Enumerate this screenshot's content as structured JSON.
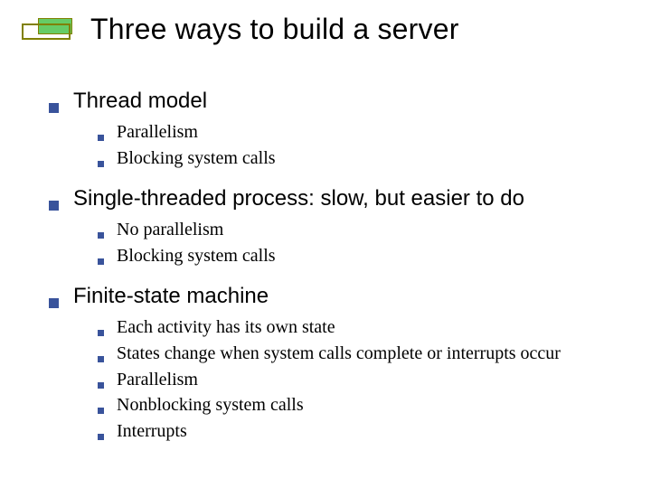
{
  "title": "Three ways to build a server",
  "items": [
    {
      "label": "Thread model",
      "sub": [
        "Parallelism",
        "Blocking system calls"
      ]
    },
    {
      "label": "Single-threaded process: slow, but easier to do",
      "sub": [
        "No parallelism",
        "Blocking system calls"
      ]
    },
    {
      "label": "Finite-state machine",
      "sub": [
        "Each activity has its own state",
        "States change when system calls complete or interrupts occur",
        "Parallelism",
        "Nonblocking system calls",
        "Interrupts"
      ]
    }
  ]
}
